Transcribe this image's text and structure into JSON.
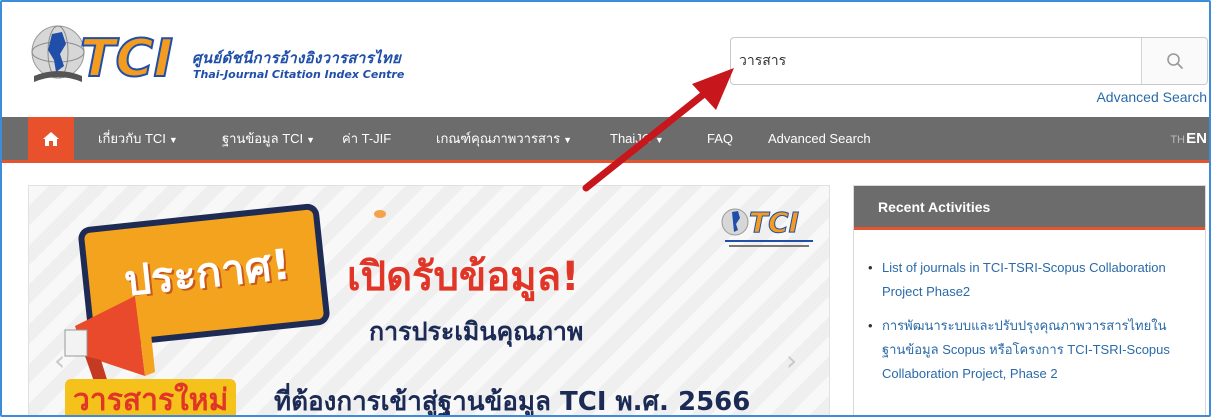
{
  "header": {
    "logo_text": "TCI",
    "logo_title_th": "ศูนย์ดัชนีการอ้างอิงวารสารไทย",
    "logo_title_en": "Thai-Journal Citation Index Centre"
  },
  "search": {
    "value": "วารสาร",
    "advanced_label": "Advanced Search",
    "icon": "search-icon"
  },
  "nav": {
    "home_icon": "home-icon",
    "items": [
      {
        "label": "เกี่ยวกับ TCI",
        "has_caret": true
      },
      {
        "label": "ฐานข้อมูล TCI",
        "has_caret": true
      },
      {
        "label": "ค่า T-JIF",
        "has_caret": false
      },
      {
        "label": "เกณฑ์คุณภาพวารสาร",
        "has_caret": true
      },
      {
        "label": "ThaiJO",
        "has_caret": true
      },
      {
        "label": "FAQ",
        "has_caret": false
      },
      {
        "label": "Advanced Search",
        "has_caret": false
      }
    ],
    "lang_th": "TH",
    "lang_en": "EN"
  },
  "banner": {
    "announce": "ประกาศ!",
    "headline": "เปิดรับข้อมูล!",
    "subhead": "การประเมินคุณภาพ",
    "tag": "วารสารใหม่",
    "tail": "ที่ต้องการเข้าสู่ฐานข้อมูล TCI พ.ศ. 2566",
    "logo_text": "TCI",
    "prev_icon": "chevron-left-icon",
    "next_icon": "chevron-right-icon"
  },
  "activities": {
    "title": "Recent Activities",
    "items": [
      "List of journals in TCI-TSRI-Scopus Collaboration Project Phase2",
      "การพัฒนาระบบและปรับปรุงคุณภาพวารสารไทยในฐานข้อมูล Scopus หรือโครงการ TCI-TSRI-Scopus Collaboration Project, Phase 2"
    ]
  },
  "colors": {
    "nav_bg": "#6c6c6c",
    "accent": "#e6542f",
    "link": "#2a6aa8",
    "brand_blue": "#1f4fa8",
    "brand_orange": "#f39c1f",
    "annotation_arrow": "#c8161d"
  }
}
